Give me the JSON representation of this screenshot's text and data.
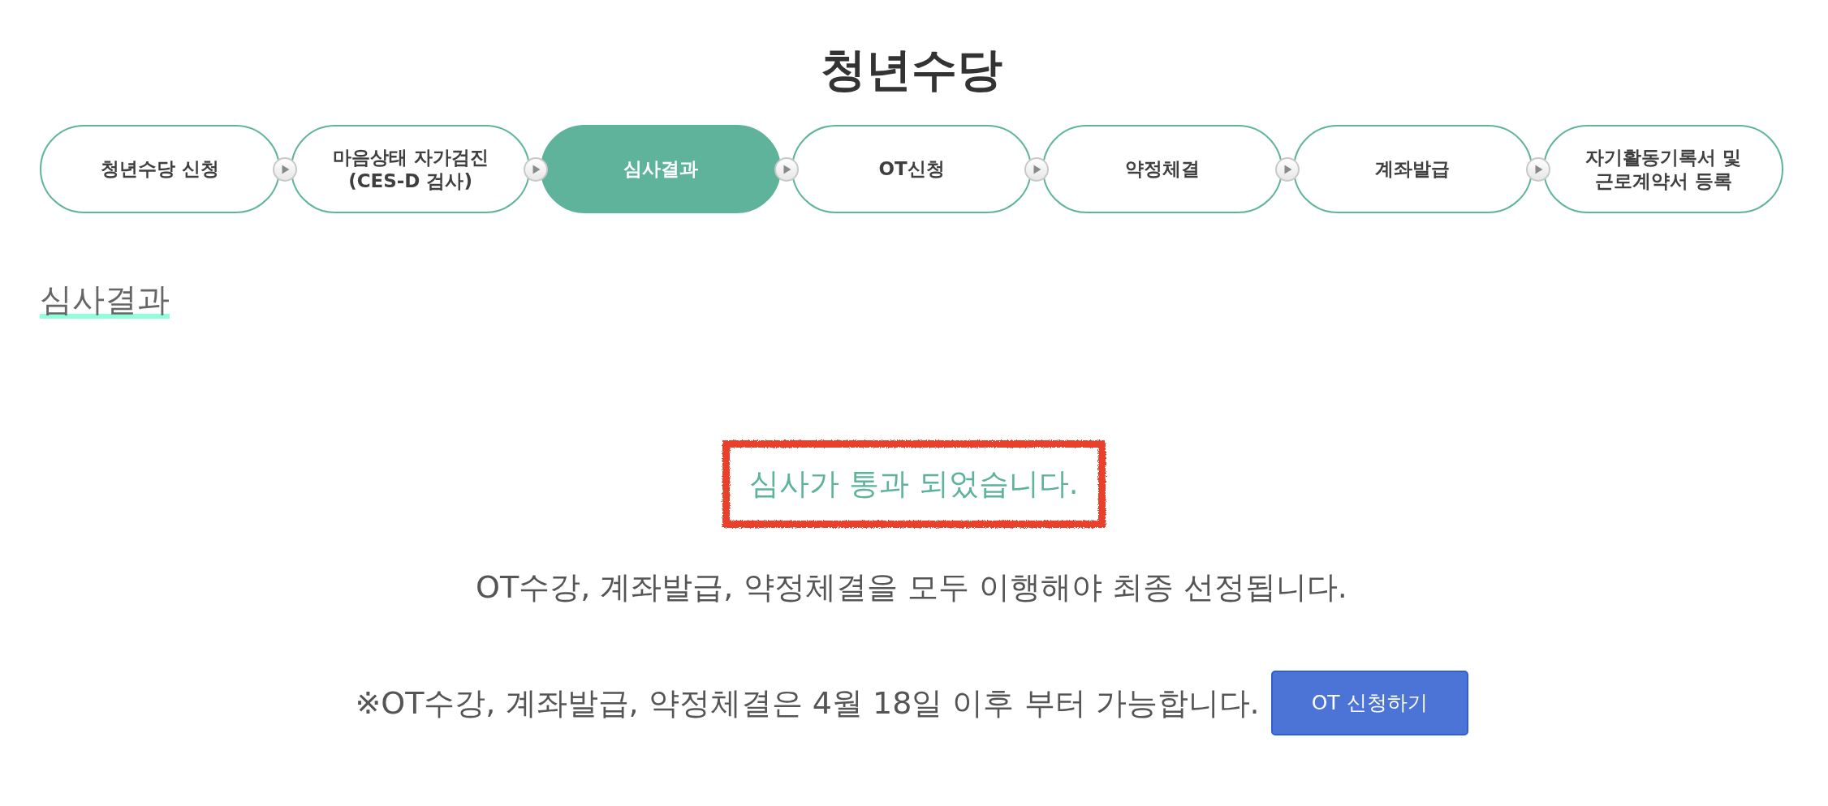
{
  "page_title": "청년수당",
  "steps": [
    {
      "label": "청년수당 신청",
      "selected": false
    },
    {
      "label": "마음상태 자가검진\n(CES-D 검사)",
      "selected": false
    },
    {
      "label": "심사결과",
      "selected": true
    },
    {
      "label": "OT신청",
      "selected": false
    },
    {
      "label": "약정체결",
      "selected": false
    },
    {
      "label": "계좌발급",
      "selected": false
    },
    {
      "label": "자기활동기록서 및\n근로계약서 등록",
      "selected": false
    }
  ],
  "section": {
    "heading": "심사결과"
  },
  "result": {
    "message": "심사가 통과 되었습니다.",
    "highlighted": true
  },
  "notice": "OT수강, 계좌발급, 약정체결을 모두 이행해야 최종 선정됩니다.",
  "availability": {
    "text": "※OT수강, 계좌발급, 약정체결은 4월 18일 이후 부터 가능합니다.",
    "button": "OT 신청하기"
  }
}
